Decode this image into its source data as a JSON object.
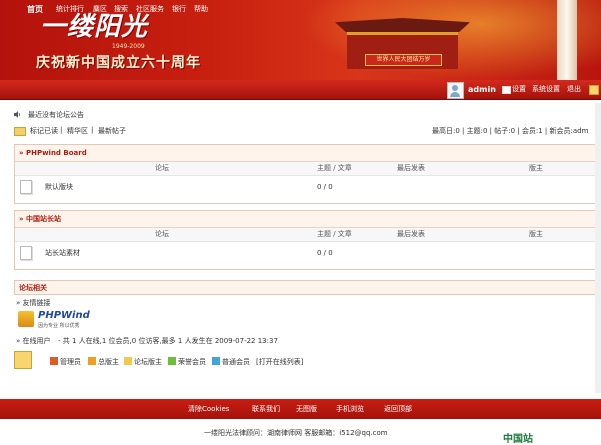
{
  "banner": {
    "logo_text": "一缕阳光",
    "logo_years": "1949-2009",
    "slogan": "庆祝新中国成立六十周年",
    "gate_sign": "世界人民大团结万岁"
  },
  "nav": {
    "home": "首页",
    "items": [
      "统计排行",
      "麋区",
      "搜索",
      "社区服务",
      "银行",
      "帮助"
    ]
  },
  "user_bar": {
    "username": "admin",
    "settings": "设置",
    "system_settings": "系统设置",
    "logout": "退出"
  },
  "notice": "最近没有论坛公告",
  "quick_links": {
    "mark_read": "标记已读",
    "digest": "精华区",
    "new_posts": "最新帖子"
  },
  "site_stats": "最高日:0 | 主题:0 | 帖子:0 | 会员:1 | 新会员:adm",
  "columns": {
    "forum": "论坛",
    "topics_posts": "主题 / 文章",
    "last_post": "最后发表",
    "moderator": "版主"
  },
  "categories": [
    {
      "name": "» PHPwind Board",
      "forums": [
        {
          "name": "默认版块",
          "counts": "0 / 0"
        }
      ]
    },
    {
      "name": "» 中国站长站",
      "forums": [
        {
          "name": "站长站素材",
          "counts": "0 / 0"
        }
      ]
    }
  ],
  "related": {
    "title": "论坛相关",
    "links_label": "» 友情链接",
    "phpwind_logo": "PHPWind",
    "phpwind_tagline": "因为专业 所以优秀",
    "online_label": "» 在线用户",
    "online_text": "- 共 1 人在线,1 位会员,0 位访客,最多 1 人发生在 2009-07-22 13:37"
  },
  "legend": {
    "items": [
      {
        "label": "管理员",
        "color": "#e05a2a"
      },
      {
        "label": "总版主",
        "color": "#f0a020"
      },
      {
        "label": "论坛版主",
        "color": "#f2c94c"
      },
      {
        "label": "荣誉会员",
        "color": "#6bbf3a"
      },
      {
        "label": "普通会员",
        "color": "#3fa8d8"
      }
    ],
    "open_list": "[打开在线列表]"
  },
  "footer": {
    "links": [
      "清除Cookies",
      "联系我们",
      "无图版",
      "手机浏览",
      "返回顶部"
    ],
    "copyright": "一缕阳光法律顾问：湖南律师网  客服邮箱：i512@qq.com",
    "corner_logo": "中国站"
  },
  "colors": {
    "brand_red": "#b3120c",
    "accent_gold": "#e0a12a"
  }
}
